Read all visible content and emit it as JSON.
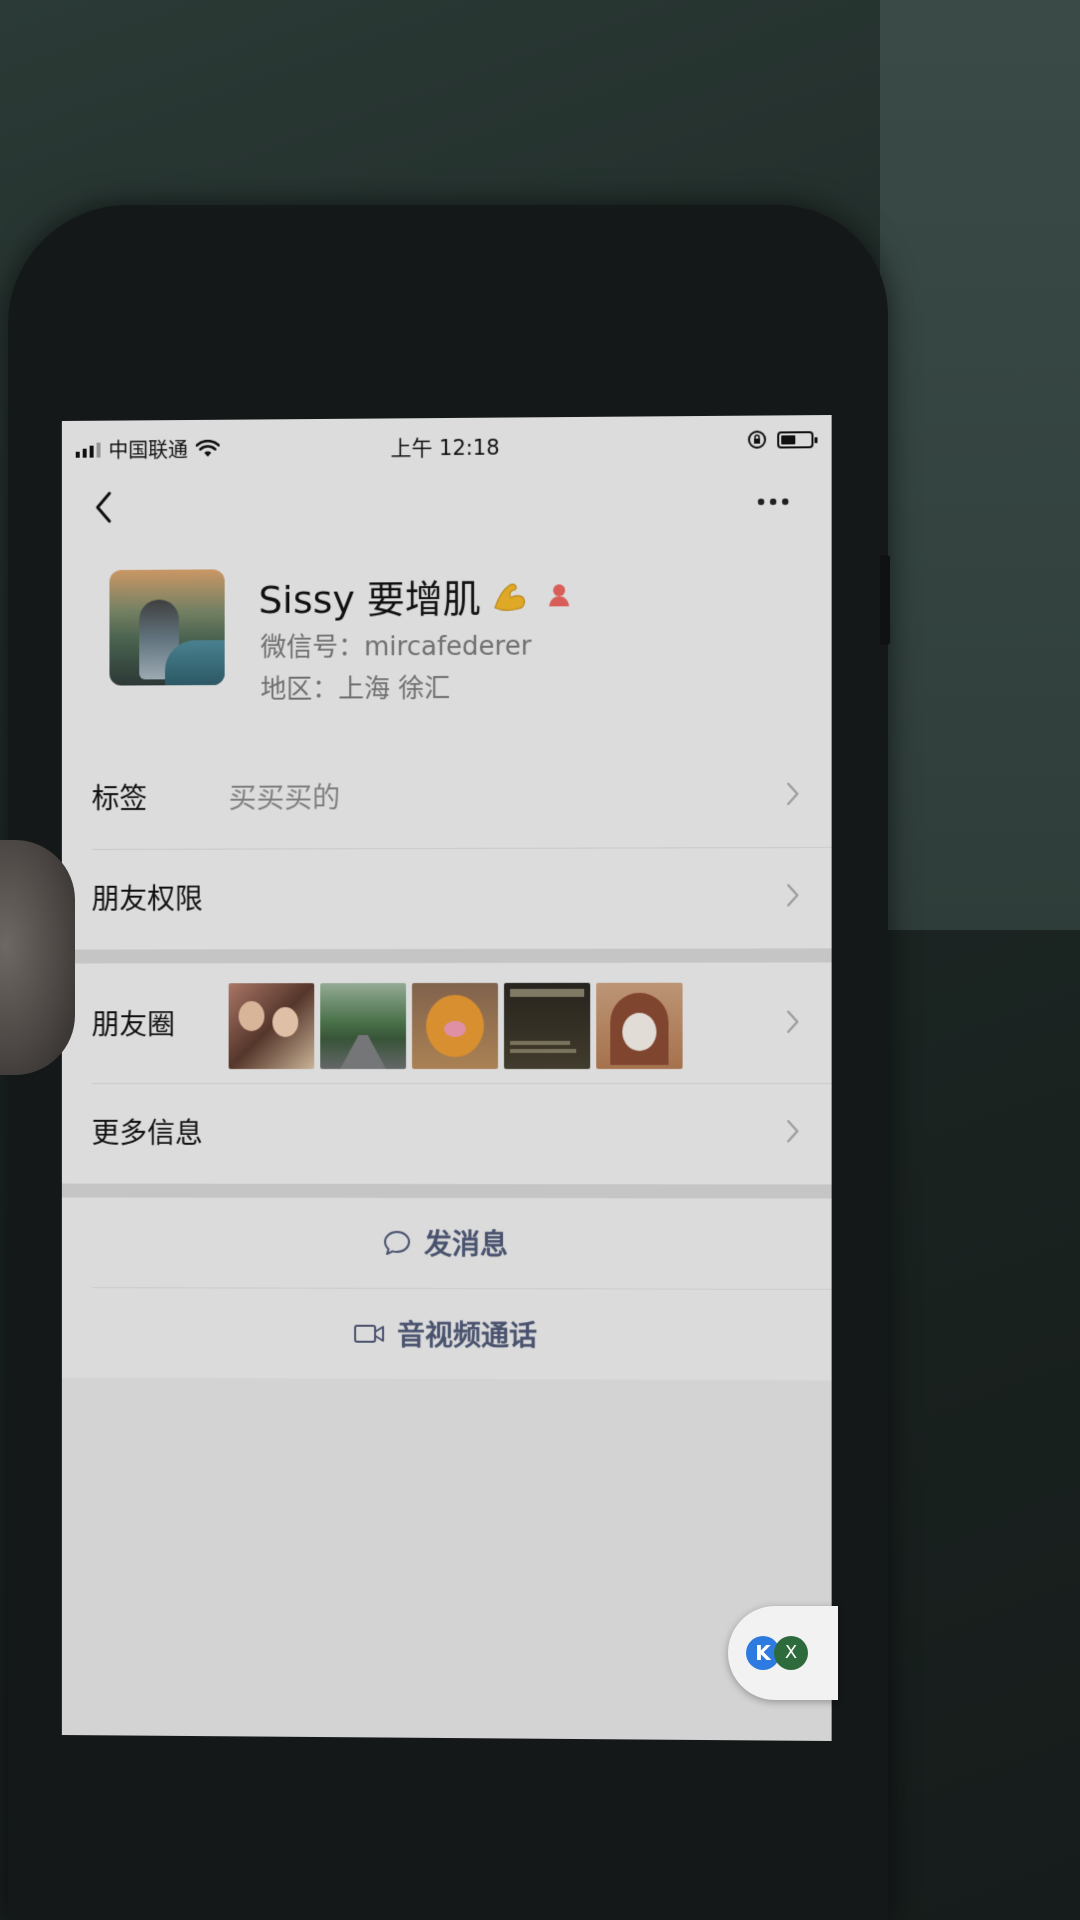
{
  "status_bar": {
    "carrier": "中国联通",
    "time": "上午 12:18"
  },
  "profile": {
    "name": "Sissy 要增肌",
    "wechat_id": "微信号：mircafederer",
    "region": "地区：上海 徐汇"
  },
  "rows": {
    "tags_label": "标签",
    "tags_value": "买买买的",
    "permissions_label": "朋友权限",
    "moments_label": "朋友圈",
    "more_info_label": "更多信息"
  },
  "actions": {
    "message_label": "发消息",
    "video_call_label": "音视频通话"
  },
  "float_widget": {
    "left_label": "K",
    "right_label": "X"
  },
  "icons": {
    "back": "chevron-left-icon",
    "more": "more-dots-icon",
    "flex": "flexed-biceps-icon",
    "gender": "female-icon",
    "chat": "chat-bubble-icon",
    "video": "video-camera-icon"
  },
  "colors": {
    "screen_bg": "#ededed",
    "action_text": "#4e5876",
    "gender_icon": "#e8655f",
    "secondary_text": "#777777"
  }
}
